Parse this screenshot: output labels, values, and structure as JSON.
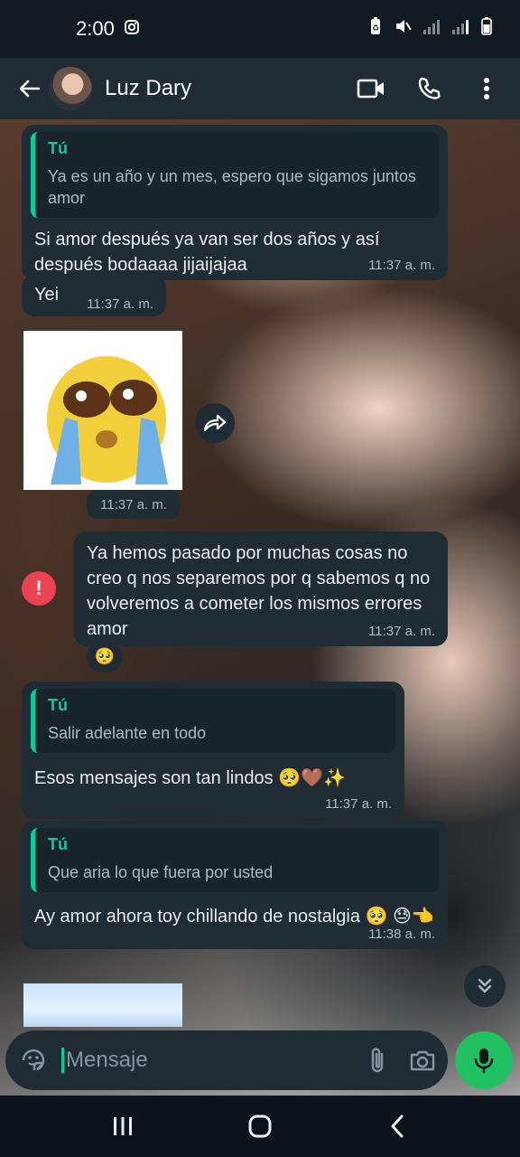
{
  "status_bar": {
    "time": "2:00",
    "icons": [
      "instagram-icon",
      "battery-saver-icon",
      "mute-icon",
      "signal-icon",
      "signal-icon",
      "battery-icon"
    ]
  },
  "header": {
    "contact_name": "Luz Dary",
    "actions": [
      "video-call-icon",
      "phone-icon",
      "more-vert-icon"
    ]
  },
  "messages": [
    {
      "type": "received",
      "quote": {
        "author": "Tú",
        "text": "Ya es un año y un mes, espero que sigamos juntos amor"
      },
      "text": "Si amor después ya van ser dos años y así después bodaaaa jijaijajaa",
      "time": "11:37 a. m."
    },
    {
      "type": "received",
      "text": "Yei",
      "time": "11:37 a. m."
    },
    {
      "type": "sticker",
      "description_icon": "crying-face-sticker",
      "time": "11:37 a. m."
    },
    {
      "type": "sent",
      "status": "failed",
      "text": "Ya hemos pasado por muchas cosas no creo q nos separemos por q sabemos q no volveremos a cometer los mismos errores amor",
      "time": "11:37 a. m.",
      "reaction": "🥺"
    },
    {
      "type": "received",
      "quote": {
        "author": "Tú",
        "text": "Salir adelante en todo"
      },
      "text": "Esos mensajes son tan lindos 🥺🤎✨",
      "time": "11:37 a. m."
    },
    {
      "type": "received",
      "quote": {
        "author": "Tú",
        "text": "Que aria lo que fuera por usted"
      },
      "text": "Ay amor ahora toy chillando de nostalgia 🥺 😓👈",
      "time": "11:38 a. m."
    }
  ],
  "composer": {
    "placeholder": "Mensaje"
  },
  "colors": {
    "accent": "#06cf9c",
    "bubble": "#1f2c34",
    "mic": "#21c063",
    "error": "#ea4354"
  }
}
